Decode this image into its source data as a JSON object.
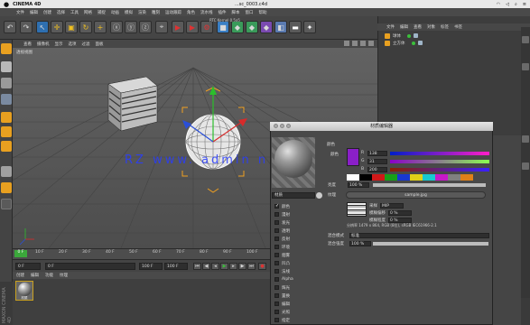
{
  "mac_menubar": {
    "app_name": "CINEMA 4D",
    "document_title": "...sc_0003.c4d",
    "status_right": [
      "",
      "",
      "",
      ""
    ]
  },
  "c4d_menu": {
    "items": [
      "文件",
      "编辑",
      "创建",
      "选择",
      "工具",
      "网格",
      "捕捉",
      "动画",
      "模拟",
      "渲染",
      "雕刻",
      "运动跟踪",
      "角色",
      "流水线",
      "插件",
      "脚本",
      "窗口",
      "帮助"
    ],
    "interface_label": "RTC Kernel 0.5a5"
  },
  "viewport": {
    "menu": [
      "查看",
      "摄像机",
      "显示",
      "选项",
      "过滤",
      "面板"
    ],
    "view_name": "透视视图"
  },
  "timeline": {
    "current_frame_marker": "0 F",
    "ticks": [
      "10 F",
      "20 F",
      "30 F",
      "40 F",
      "50 F",
      "60 F",
      "70 F",
      "80 F",
      "90 F",
      "100 F"
    ],
    "start_field": "0 F",
    "current_field": "0 F",
    "end_field": "100 F",
    "max_field": "100 F"
  },
  "material_manager": {
    "menu": [
      "创建",
      "编辑",
      "功能",
      "纹理"
    ],
    "material_name": "材质",
    "brand": "MAXON CINEMA 4D"
  },
  "object_manager": {
    "menu": [
      "文件",
      "编辑",
      "查看",
      "对象",
      "标签",
      "书签"
    ],
    "objects": [
      {
        "name": "球体"
      },
      {
        "name": "立方体"
      }
    ]
  },
  "material_editor": {
    "title": "材质编辑器",
    "material_name": "材质",
    "channels": [
      {
        "label": "颜色",
        "checked": true
      },
      {
        "label": "漫射",
        "checked": false
      },
      {
        "label": "发光",
        "checked": false
      },
      {
        "label": "透明",
        "checked": false
      },
      {
        "label": "反射",
        "checked": false
      },
      {
        "label": "环境",
        "checked": false
      },
      {
        "label": "烟雾",
        "checked": false
      },
      {
        "label": "凹凸",
        "checked": false
      },
      {
        "label": "法线",
        "checked": false
      },
      {
        "label": "Alpha",
        "checked": false
      },
      {
        "label": "辉光",
        "checked": false
      },
      {
        "label": "置换",
        "checked": false
      },
      {
        "label": "编辑",
        "checked": false
      },
      {
        "label": "光照",
        "checked": false
      },
      {
        "label": "指定",
        "checked": false
      }
    ],
    "color_section_label": "颜色",
    "color_label": "颜色",
    "color_hex": "#8a1fc8",
    "rgb": {
      "r_label": "R",
      "r_value": "138",
      "g_label": "G",
      "g_value": "31",
      "b_label": "B",
      "b_value": "200"
    },
    "brightness_label": "亮度",
    "brightness_value": "100 %",
    "texture_label": "纹理",
    "texture_name": "sample.jpg",
    "sampling_label": "采样",
    "sampling_value": "MIP",
    "blur_offset_label": "模糊偏移",
    "blur_offset_value": "0 %",
    "blur_scale_label": "模糊程度",
    "blur_scale_value": "0 %",
    "texture_info": "分辨率 1479 x 864, RGB (8位), sRGB IEC61966-2.1",
    "mix_mode_label": "混合模式",
    "mix_mode_value": "标准",
    "mix_strength_label": "混合强度",
    "mix_strength_value": "100 %"
  },
  "watermark": "RZ  www. admin  n"
}
